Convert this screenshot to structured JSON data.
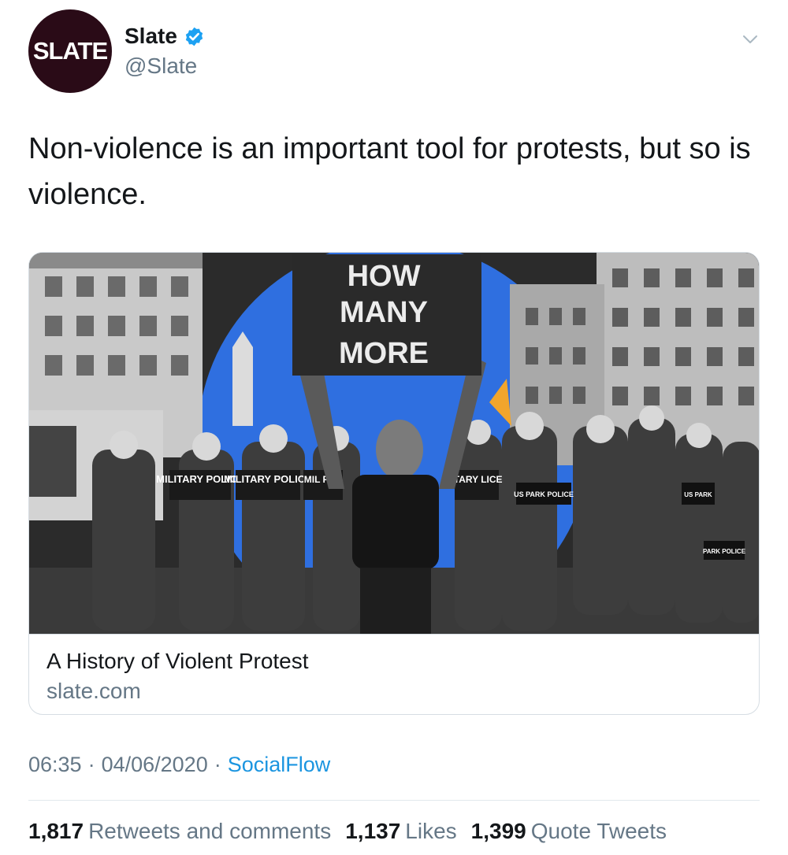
{
  "account": {
    "avatar_text": "SLATE",
    "display_name": "Slate",
    "handle": "@Slate"
  },
  "tweet": {
    "text": "Non-violence is an important tool for protests, but so is violence."
  },
  "card": {
    "image_description_icon": "photo-protest",
    "sign_text": [
      "HOW",
      "MANY",
      "MORE"
    ],
    "shield_texts": [
      "MILITARY POLICE",
      "MILITARY POLICE",
      "MIL POL",
      "ITARY LICE",
      "US PARK POLICE",
      "US PARK",
      "PARK POLICE"
    ],
    "title": "A History of Violent Protest",
    "domain": "slate.com"
  },
  "meta": {
    "time": "06:35",
    "date": "04/06/2020",
    "source": "SocialFlow"
  },
  "stats": {
    "retweets_count": "1,817",
    "retweets_label": "Retweets and comments",
    "likes_count": "1,137",
    "likes_label": "Likes",
    "quotes_count": "1,399",
    "quotes_label": "Quote Tweets"
  },
  "colors": {
    "avatar_bg": "#2a0b17",
    "verified": "#1da1f2",
    "link": "#1b95e0",
    "muted": "#657786",
    "accent_blue_circle": "#2f6fe0"
  }
}
